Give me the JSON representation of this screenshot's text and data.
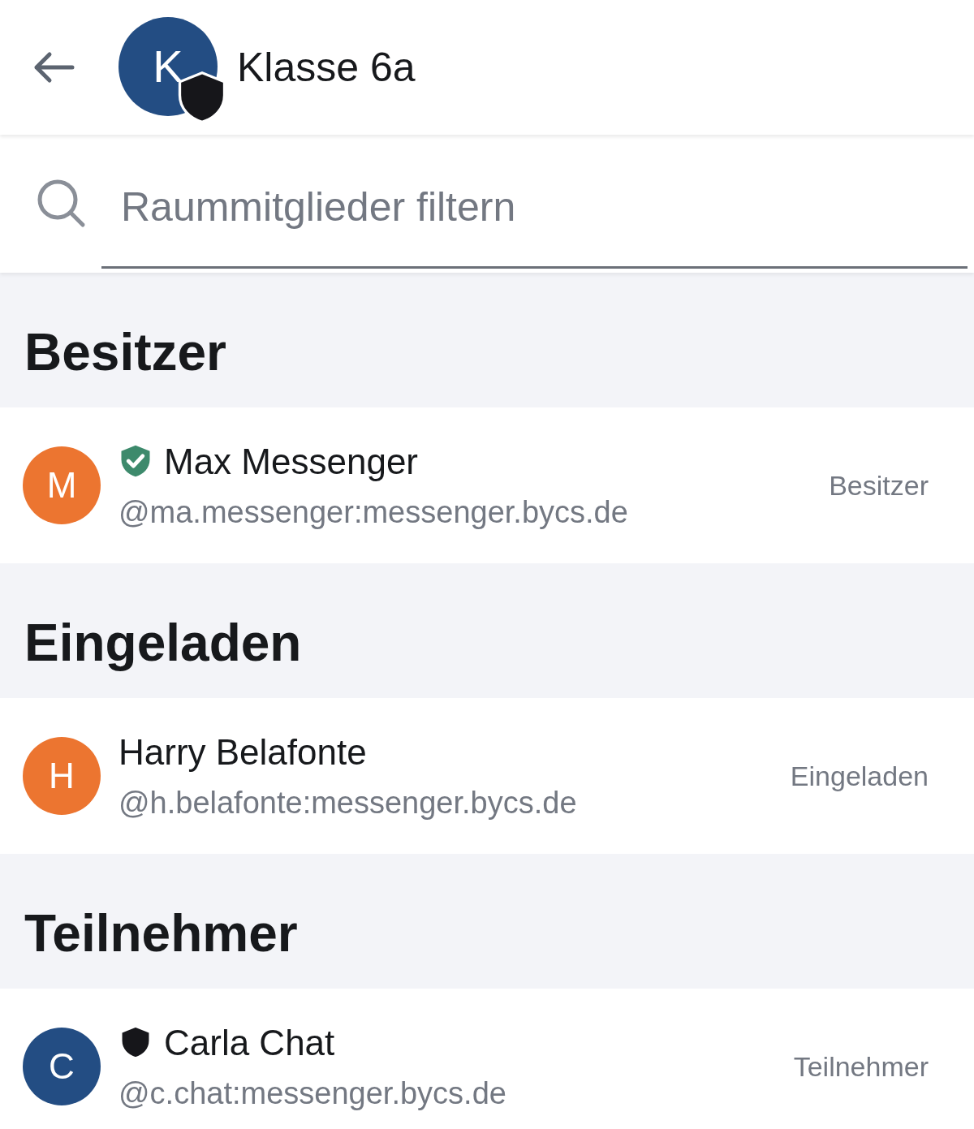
{
  "header": {
    "avatar_letter": "K",
    "shield": true,
    "title": "Klasse 6a"
  },
  "search": {
    "placeholder": "Raummitglieder filtern"
  },
  "sections": [
    {
      "title": "Besitzer",
      "members": [
        {
          "initial": "M",
          "color": "#ec7530",
          "verified": true,
          "shield": false,
          "name": "Max Messenger",
          "handle": "@ma.messenger:messenger.bycs.de",
          "role": "Besitzer"
        }
      ]
    },
    {
      "title": "Eingeladen",
      "members": [
        {
          "initial": "H",
          "color": "#ec7530",
          "verified": false,
          "shield": false,
          "name": "Harry Belafonte",
          "handle": "@h.belafonte:messenger.bycs.de",
          "role": "Eingeladen"
        }
      ]
    },
    {
      "title": "Teilnehmer",
      "members": [
        {
          "initial": "C",
          "color": "#234d83",
          "verified": false,
          "shield": true,
          "name": "Carla Chat",
          "handle": "@c.chat:messenger.bycs.de",
          "role": "Teilnehmer"
        }
      ]
    }
  ]
}
